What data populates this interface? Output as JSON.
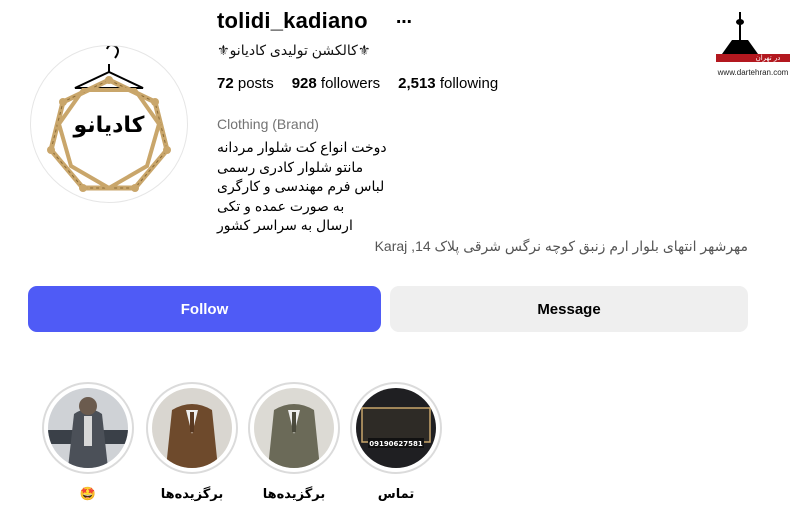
{
  "profile": {
    "username": "tolidi_kadiano",
    "more_icon": "⋯",
    "full_name": "⚜کالکشن تولیدی کادیانو⚜",
    "avatar_text": "کادیانو",
    "posts_count": "72",
    "posts_label": "posts",
    "followers_count": "928",
    "followers_label": "followers",
    "following_count": "2,513",
    "following_label": "following",
    "category": "Clothing (Brand)",
    "bio": [
      "دوخت انواع کت شلوار مردانه",
      "مانتو شلوار کادری رسمی",
      "لباس فرم مهندسی و کارگری",
      "به صورت عمده و تکی",
      "ارسال به سراسر کشور"
    ],
    "address": "مهرشهر انتهای بلوار ارم زنبق کوچه نرگس شرقی پلاک 14, Karaj"
  },
  "actions": {
    "follow_label": "Follow",
    "message_label": "Message"
  },
  "highlights": [
    {
      "label": "🤩",
      "image": "man-suit-banner"
    },
    {
      "label": "برگزیده‌ها",
      "image": "brown-suit"
    },
    {
      "label": "برگزیده‌ها",
      "image": "olive-suit"
    },
    {
      "label": "تماس",
      "image": "contact-card",
      "phone": "09190627581"
    }
  ],
  "watermark": {
    "site": "www.dartehran.com",
    "logo_text": "در تهران"
  },
  "colors": {
    "follow_bg": "#4f5bf6",
    "message_bg": "#efefef",
    "avatar_gold": "#c9a66b",
    "muted": "#737373"
  }
}
